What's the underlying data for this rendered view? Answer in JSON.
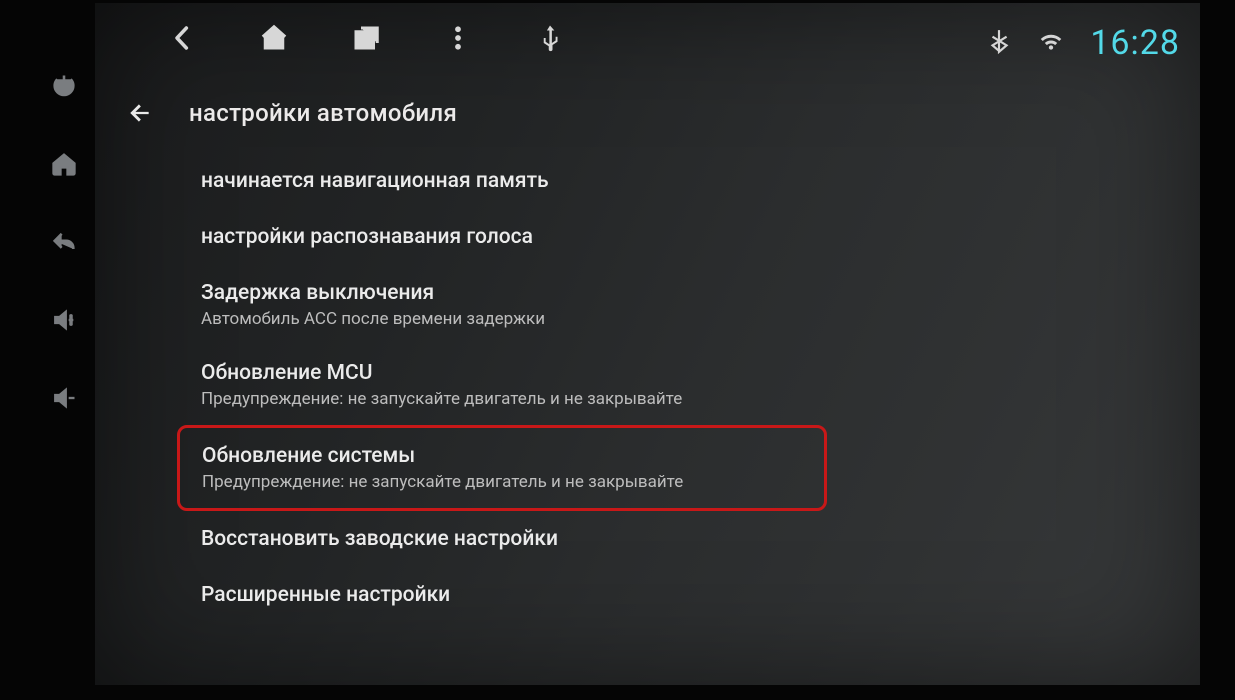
{
  "statusbar": {
    "time": "16:28"
  },
  "header": {
    "title": "настройки автомобиля"
  },
  "settings": [
    {
      "title": "начинается навигационная память",
      "sub": ""
    },
    {
      "title": "настройки распознавания голоса",
      "sub": ""
    },
    {
      "title": "Задержка выключения",
      "sub": "Автомобиль ACC после времени задержки"
    },
    {
      "title": "Обновление MCU",
      "sub": "Предупреждение: не запускайте двигатель и не закрывайте"
    },
    {
      "title": "Обновление системы",
      "sub": "Предупреждение: не запускайте двигатель и не закрывайте"
    },
    {
      "title": "Восстановить заводские настройки",
      "sub": ""
    },
    {
      "title": "Расширенные настройки",
      "sub": ""
    }
  ]
}
